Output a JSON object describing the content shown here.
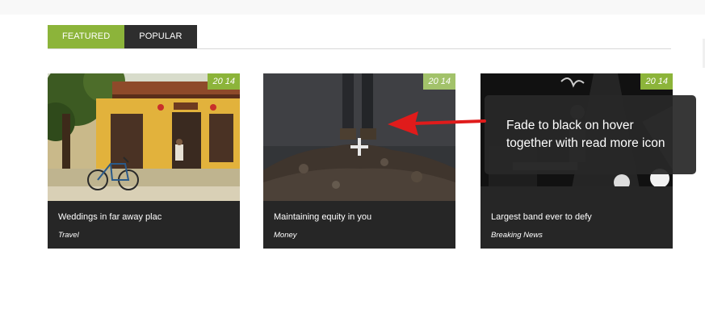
{
  "tabs": [
    {
      "label": "FEATURED",
      "active": true
    },
    {
      "label": "POPULAR",
      "active": false
    }
  ],
  "cards": [
    {
      "badge": "20 14",
      "title": "Weddings in far away plac",
      "category": "Travel",
      "image": "yellow-house-bicycle-photo"
    },
    {
      "badge": "20 14",
      "title": "Maintaining equity in you",
      "category": "Money",
      "image": "legs-on-rocks-photo"
    },
    {
      "badge": "20 14",
      "title": "Largest band ever to defy",
      "category": "Breaking News",
      "image": "concert-band-photo"
    }
  ],
  "annotation": {
    "line1": "Fade to black on hover",
    "line2": "together with  read more icon"
  },
  "colors": {
    "accent": "#8cb43a",
    "tab_dark": "#2e2e2e",
    "card_bg": "#262626",
    "arrow": "#e01b1b"
  },
  "icons": {
    "read_more": "plus-icon",
    "pointer": "red-arrow-icon"
  }
}
